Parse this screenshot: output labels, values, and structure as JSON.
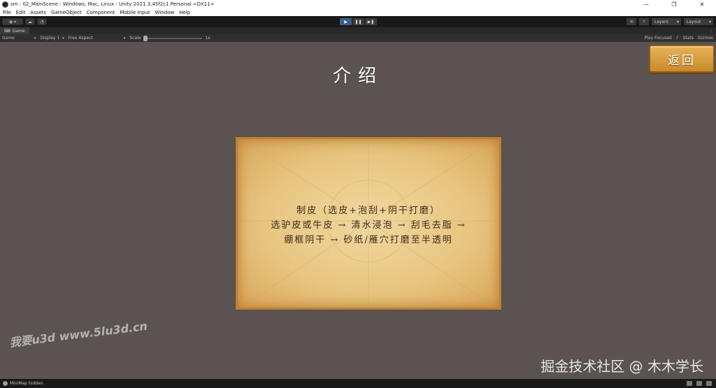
{
  "window": {
    "title": "sm - 02_MainScene - Windows, Mac, Linux - Unity 2021.3.45f2c1 Personal <DX11>",
    "minimize": "—",
    "restore": "❐",
    "close": "✕"
  },
  "menu": {
    "items": [
      "File",
      "Edit",
      "Assets",
      "GameObject",
      "Component",
      "Mobile Input",
      "Window",
      "Help"
    ]
  },
  "toolbar": {
    "account_label": "",
    "play": "▶",
    "pause": "❚❚",
    "step": "▶❚",
    "layers_label": "Layers",
    "layout_label": "Layout"
  },
  "tabs": {
    "game_tab": "Game"
  },
  "game_controls": {
    "mode": "Game",
    "display": "Display 1",
    "aspect": "Free Aspect",
    "scale_label": "Scale",
    "scale_value": "1x",
    "play_focused": "Play Focused",
    "stats": "Stats",
    "gizmos": "Gizmos"
  },
  "scene": {
    "title": "介绍",
    "back_button": "返回",
    "scroll_lines": [
      "制皮（选皮+泡刮+阴干打磨）",
      "选驴皮或牛皮 → 清水浸泡 → 刮毛去脂 →",
      "绷框阴干 → 砂纸/雁穴打磨至半透明"
    ]
  },
  "watermarks": {
    "left": "我要u3d www.5lu3d.cn",
    "right": "掘金技术社区 @ 木木学长"
  },
  "status": {
    "message": "MiniMap hidden."
  },
  "colors": {
    "game_bg": "#5a5352",
    "parchment": "#e8c681",
    "button_wood": "#d99c3e",
    "play_active": "#3d5f8a"
  }
}
